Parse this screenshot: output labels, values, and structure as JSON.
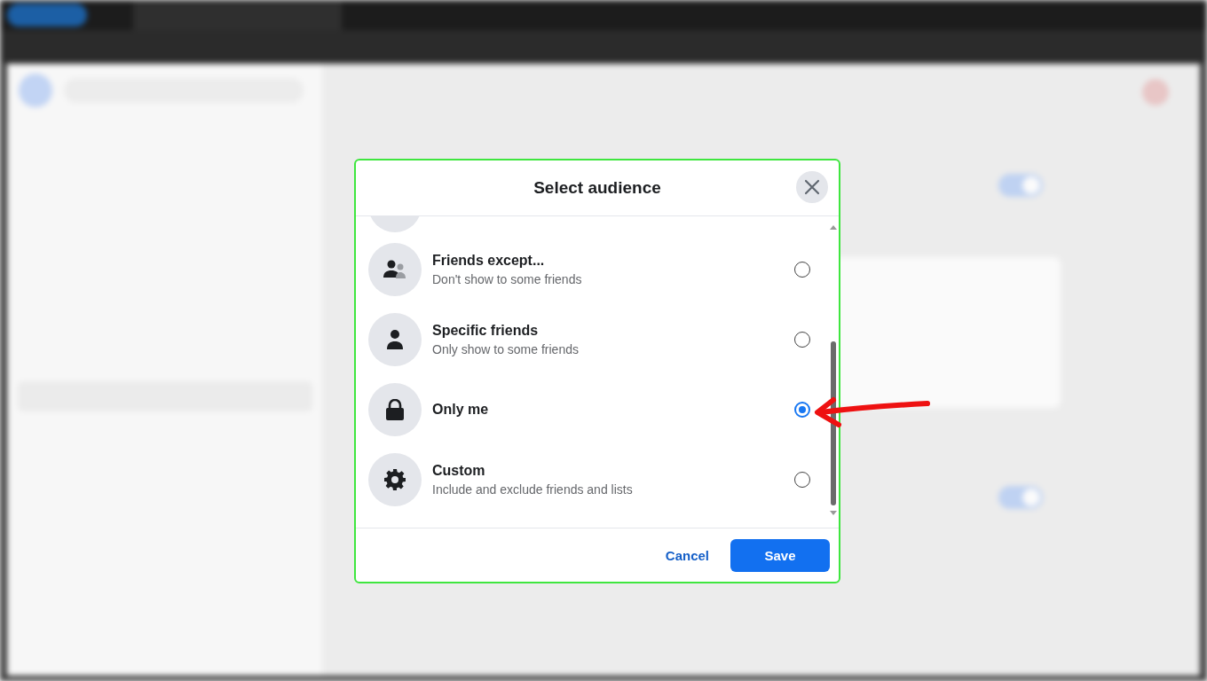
{
  "dialog": {
    "title": "Select audience",
    "options": [
      {
        "kind": "people",
        "title": "Friends except...",
        "subtitle": "Don't show to some friends",
        "selected": false
      },
      {
        "kind": "person",
        "title": "Specific friends",
        "subtitle": "Only show to some friends",
        "selected": false
      },
      {
        "kind": "lock",
        "title": "Only me",
        "selected": true
      },
      {
        "kind": "gear",
        "title": "Custom",
        "subtitle": "Include and exclude friends and lists",
        "selected": false
      }
    ],
    "cancel": "Cancel",
    "save": "Save"
  },
  "background_toggles": [
    {
      "on": true
    },
    {
      "on": true
    }
  ]
}
